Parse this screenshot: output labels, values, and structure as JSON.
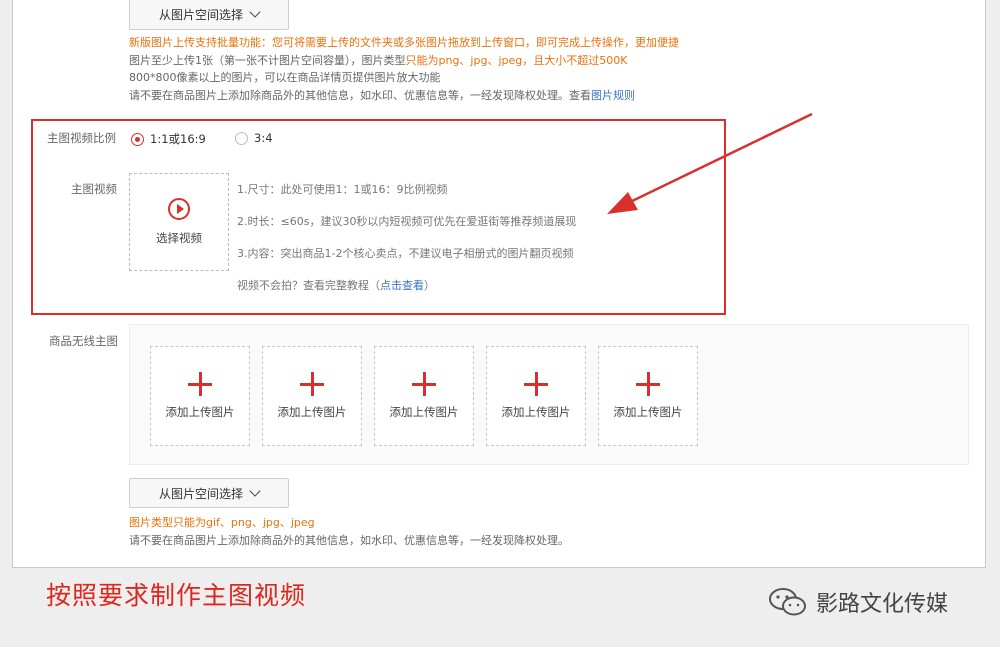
{
  "top": {
    "select_button": "从图片空间选择",
    "hint_line1": "新版图片上传支持批量功能：您可将需要上传的文件夹或多张图片拖放到上传窗口，即可完成上传操作，更加便捷",
    "hint_line2_pre": "图片至少上传1张（第一张不计图片空间容量），图片类型",
    "hint_line2_orange": "只能为png、jpg、jpeg，且大小不超过500K",
    "hint_line3": "800*800像素以上的图片，可以在商品详情页提供图片放大功能",
    "hint_line4_pre": "请不要在商品图片上添加除商品外的其他信息，如水印、优惠信息等，一经发现降权处理。查看",
    "hint_line4_link": "图片规则"
  },
  "video_section": {
    "ratio_label": "主图视频比例",
    "ratio_options": [
      {
        "label": "1:1或16:9",
        "selected": true
      },
      {
        "label": "3:4",
        "selected": false
      }
    ],
    "video_label": "主图视频",
    "select_video": "选择视频",
    "play_icon": "play-circle-icon",
    "info_size": "1.尺寸：此处可使用1：1或16：9比例视频",
    "info_duration": "2.时长：≤60s，建议30秒以内短视频可优先在爱逛街等推荐频道展现",
    "info_content": "3.内容：突出商品1-2个核心卖点，不建议电子相册式的图片翻页视频",
    "tutorial_pre": "视频不会拍？查看完整教程（",
    "tutorial_link": "点击查看",
    "tutorial_post": "）"
  },
  "wireless": {
    "label": "商品无线主图",
    "slots": [
      "添加上传图片",
      "添加上传图片",
      "添加上传图片",
      "添加上传图片",
      "添加上传图片"
    ],
    "select_button": "从图片空间选择",
    "hint_line1_pre": "图片类型",
    "hint_line1_orange": "只能为gif、png、jpg、jpeg",
    "hint_line2": "请不要在商品图片上添加除商品外的其他信息，如水印、优惠信息等，一经发现降权处理。"
  },
  "caption": "按照要求制作主图视频",
  "brand": "影路文化传媒",
  "colors": {
    "accent": "#d9302c",
    "orange": "#e8720c",
    "link": "#3a73c3"
  }
}
